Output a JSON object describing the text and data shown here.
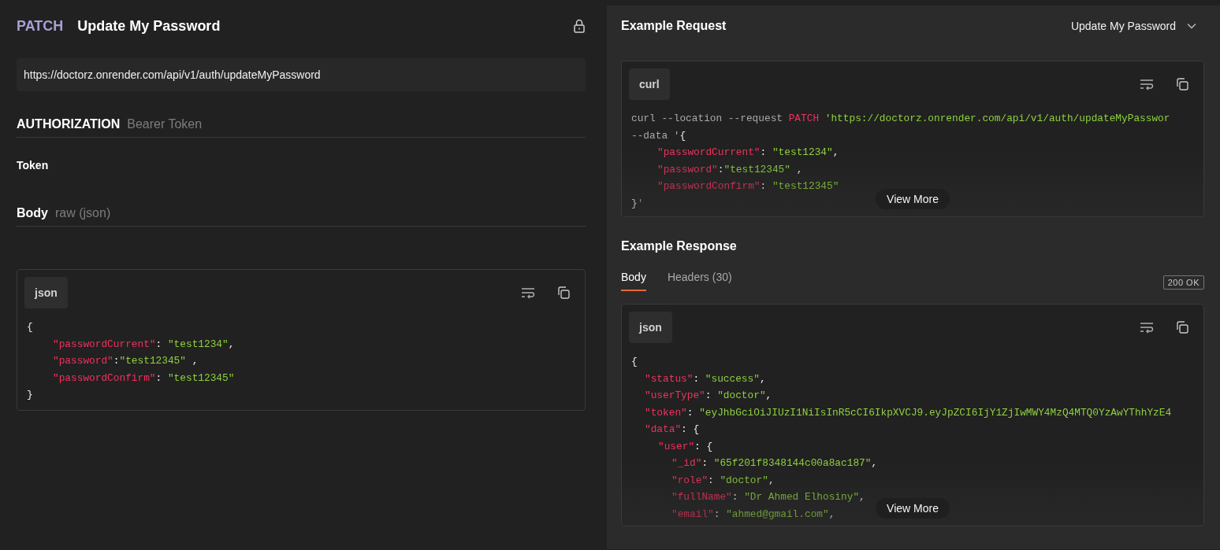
{
  "request": {
    "method": "PATCH",
    "title": "Update My Password",
    "url": "https://doctorz.onrender.com/api/v1/auth/updateMyPassword",
    "authorization": {
      "label": "AUTHORIZATION",
      "type": "Bearer Token"
    },
    "token_label": "Token",
    "body": {
      "label": "Body",
      "type": "raw (json)",
      "code": {
        "language": "json",
        "lines": [
          {
            "tokens": [
              {
                "kind": "plain",
                "text": "{"
              }
            ],
            "children": [
              {
                "tokens": [
                  {
                    "kind": "key",
                    "text": "\"passwordCurrent\""
                  },
                  {
                    "kind": "plain",
                    "text": ": "
                  },
                  {
                    "kind": "string",
                    "text": "\"test1234\""
                  },
                  {
                    "kind": "plain",
                    "text": ","
                  }
                ]
              },
              {
                "tokens": [
                  {
                    "kind": "key",
                    "text": "\"password\""
                  },
                  {
                    "kind": "plain",
                    "text": ":"
                  },
                  {
                    "kind": "string",
                    "text": "\"test12345\""
                  },
                  {
                    "kind": "plain",
                    "text": " ,"
                  }
                ]
              },
              {
                "tokens": [
                  {
                    "kind": "key",
                    "text": "\"passwordConfirm\""
                  },
                  {
                    "kind": "plain",
                    "text": ": "
                  },
                  {
                    "kind": "string",
                    "text": "\"test12345\""
                  }
                ]
              }
            ]
          },
          {
            "tokens": [
              {
                "kind": "plain",
                "text": "}"
              }
            ]
          }
        ]
      }
    }
  },
  "example_request": {
    "title": "Example Request",
    "selector": "Update My Password",
    "code": {
      "language": "curl",
      "view_more": "View More",
      "lines": [
        {
          "tokens": [
            {
              "kind": "muted",
              "text": "curl --location --request "
            },
            {
              "kind": "key",
              "text": "PATCH"
            },
            {
              "kind": "string",
              "text": " 'https://doctorz.onrender.com/api/v1/auth/updateMyPasswor"
            }
          ]
        },
        {
          "tokens": [
            {
              "kind": "muted",
              "text": "--data '"
            },
            {
              "kind": "plain",
              "text": "{"
            }
          ],
          "children": [
            {
              "tokens": [
                {
                  "kind": "key",
                  "text": "\"passwordCurrent\""
                },
                {
                  "kind": "plain",
                  "text": ": "
                },
                {
                  "kind": "string",
                  "text": "\"test1234\""
                },
                {
                  "kind": "plain",
                  "text": ","
                }
              ]
            },
            {
              "tokens": [
                {
                  "kind": "key",
                  "text": "\"password\""
                },
                {
                  "kind": "plain",
                  "text": ":"
                },
                {
                  "kind": "string",
                  "text": "\"test12345\""
                },
                {
                  "kind": "plain",
                  "text": " ,"
                }
              ]
            },
            {
              "tokens": [
                {
                  "kind": "key",
                  "text": "\"passwordConfirm\""
                },
                {
                  "kind": "plain",
                  "text": ": "
                },
                {
                  "kind": "string",
                  "text": "\"test12345\""
                }
              ]
            }
          ]
        },
        {
          "tokens": [
            {
              "kind": "plain",
              "text": "}"
            },
            {
              "kind": "muted",
              "text": "'"
            }
          ]
        }
      ]
    }
  },
  "example_response": {
    "title": "Example Response",
    "tabs": [
      {
        "label": "Body",
        "selected": true
      },
      {
        "label": "Headers (30)",
        "selected": false
      }
    ],
    "status": "200 OK",
    "code": {
      "language": "json",
      "view_more": "View More",
      "lines": [
        {
          "tokens": [
            {
              "kind": "plain",
              "text": "{"
            }
          ],
          "children": [
            {
              "tokens": [
                {
                  "kind": "key",
                  "text": "\"status\""
                },
                {
                  "kind": "plain",
                  "text": ": "
                },
                {
                  "kind": "string",
                  "text": "\"success\""
                },
                {
                  "kind": "plain",
                  "text": ","
                }
              ]
            },
            {
              "tokens": [
                {
                  "kind": "key",
                  "text": "\"userType\""
                },
                {
                  "kind": "plain",
                  "text": ": "
                },
                {
                  "kind": "string",
                  "text": "\"doctor\""
                },
                {
                  "kind": "plain",
                  "text": ","
                }
              ]
            },
            {
              "tokens": [
                {
                  "kind": "key",
                  "text": "\"token\""
                },
                {
                  "kind": "plain",
                  "text": ": "
                },
                {
                  "kind": "string",
                  "text": "\"eyJhbGciOiJIUzI1NiIsInR5cCI6IkpXVCJ9.eyJpZCI6IjY1ZjIwMWY4MzQ4MTQ0YzAwYThhYzE4"
                }
              ]
            },
            {
              "tokens": [
                {
                  "kind": "key",
                  "text": "\"data\""
                },
                {
                  "kind": "plain",
                  "text": ": {"
                }
              ],
              "children": [
                {
                  "tokens": [
                    {
                      "kind": "key",
                      "text": "\"user\""
                    },
                    {
                      "kind": "plain",
                      "text": ": {"
                    }
                  ],
                  "children": [
                    {
                      "tokens": [
                        {
                          "kind": "key",
                          "text": "\"_id\""
                        },
                        {
                          "kind": "plain",
                          "text": ": "
                        },
                        {
                          "kind": "string",
                          "text": "\"65f201f8348144c00a8ac187\""
                        },
                        {
                          "kind": "plain",
                          "text": ","
                        }
                      ]
                    },
                    {
                      "tokens": [
                        {
                          "kind": "key",
                          "text": "\"role\""
                        },
                        {
                          "kind": "plain",
                          "text": ": "
                        },
                        {
                          "kind": "string",
                          "text": "\"doctor\""
                        },
                        {
                          "kind": "plain",
                          "text": ","
                        }
                      ]
                    },
                    {
                      "tokens": [
                        {
                          "kind": "key",
                          "text": "\"fullName\""
                        },
                        {
                          "kind": "plain",
                          "text": ": "
                        },
                        {
                          "kind": "string",
                          "text": "\"Dr Ahmed Elhosiny\""
                        },
                        {
                          "kind": "plain",
                          "text": ","
                        }
                      ]
                    },
                    {
                      "tokens": [
                        {
                          "kind": "key",
                          "text": "\"email\""
                        },
                        {
                          "kind": "plain",
                          "text": ": "
                        },
                        {
                          "kind": "string",
                          "text": "\"ahmed@gmail.com\""
                        },
                        {
                          "kind": "plain",
                          "text": ","
                        }
                      ]
                    }
                  ]
                }
              ]
            }
          ]
        }
      ]
    }
  }
}
